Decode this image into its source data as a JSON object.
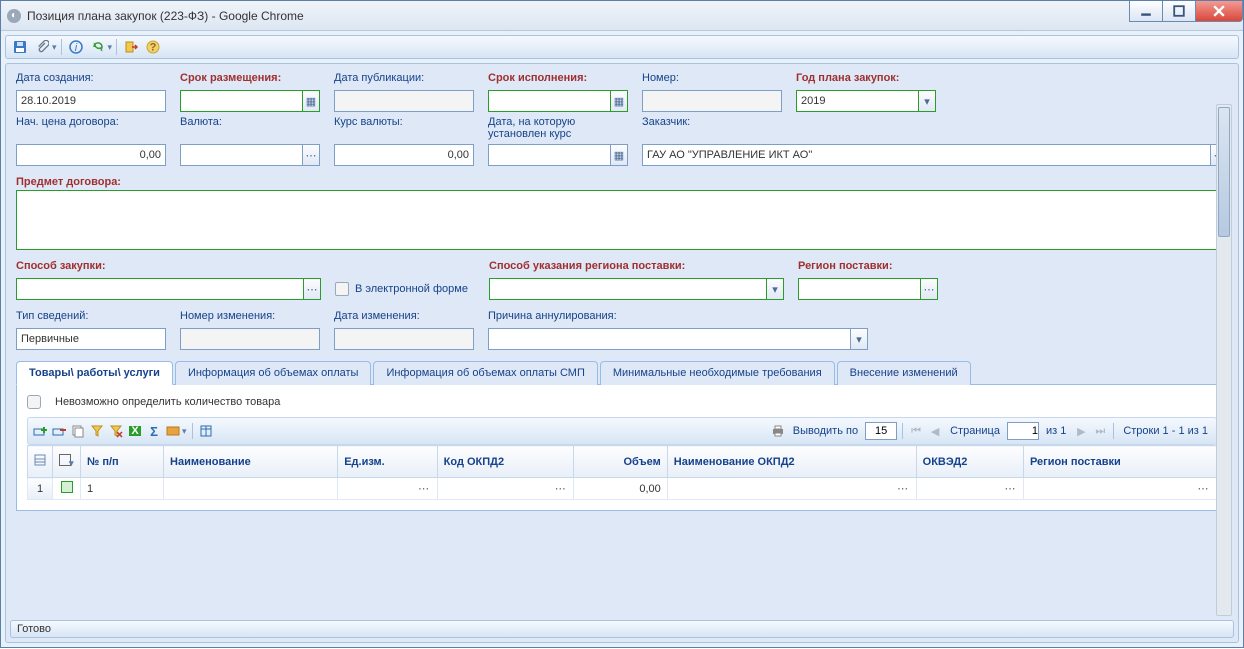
{
  "window": {
    "title": "Позиция плана закупок (223-ФЗ) - Google Chrome"
  },
  "form": {
    "createDate": {
      "label": "Дата создания:",
      "value": "28.10.2019"
    },
    "placeDeadline": {
      "label": "Срок размещения:",
      "value": ""
    },
    "pubDate": {
      "label": "Дата публикации:",
      "value": ""
    },
    "execDeadline": {
      "label": "Срок исполнения:",
      "value": ""
    },
    "number": {
      "label": "Номер:",
      "value": ""
    },
    "planYear": {
      "label": "Год плана закупок:",
      "value": "2019"
    },
    "startPrice": {
      "label": "Нач. цена договора:",
      "value": "0,00"
    },
    "currency": {
      "label": "Валюта:",
      "value": ""
    },
    "rate": {
      "label": "Курс валюты:",
      "value": "0,00"
    },
    "rateDate": {
      "label": "Дата, на которую установлен курс",
      "value": ""
    },
    "customer": {
      "label": "Заказчик:",
      "value": "ГАУ АО \"УПРАВЛЕНИЕ ИКТ АО\""
    },
    "subject": {
      "label": "Предмет договора:",
      "value": ""
    },
    "purchaseMethod": {
      "label": "Способ закупки:",
      "value": ""
    },
    "eform": {
      "label": "В электронной форме"
    },
    "regionMode": {
      "label": "Способ указания региона поставки:",
      "value": ""
    },
    "region": {
      "label": "Регион поставки:",
      "value": ""
    },
    "infoType": {
      "label": "Тип сведений:",
      "value": "Первичные"
    },
    "changeNum": {
      "label": "Номер изменения:",
      "value": ""
    },
    "changeDate": {
      "label": "Дата изменения:",
      "value": ""
    },
    "cancelReason": {
      "label": "Причина аннулирования:",
      "value": ""
    }
  },
  "tabs": {
    "goods": "Товары\\ работы\\ услуги",
    "payInfo": "Информация об объемах оплаты",
    "payInfoSmp": "Информация об объемах оплаты СМП",
    "minReq": "Минимальные необходимые требования",
    "changes": "Внесение изменений"
  },
  "goods": {
    "cantDetermine": "Невозможно определить количество товара",
    "paging": {
      "outputBy": "Выводить по",
      "perPage": "15",
      "pageLabel": "Страница",
      "page": "1",
      "ofPages": "из 1",
      "rows": "Строки 1 - 1 из 1"
    },
    "cols": {
      "npp": "№ п/п",
      "name": "Наименование",
      "unit": "Ед.изм.",
      "okpd": "Код ОКПД2",
      "volume": "Объем",
      "okpdName": "Наименование ОКПД2",
      "okved": "ОКВЭД2",
      "region": "Регион поставки"
    },
    "row": {
      "idx": "1",
      "npp": "1",
      "volume": "0,00"
    }
  },
  "status": "Готово"
}
